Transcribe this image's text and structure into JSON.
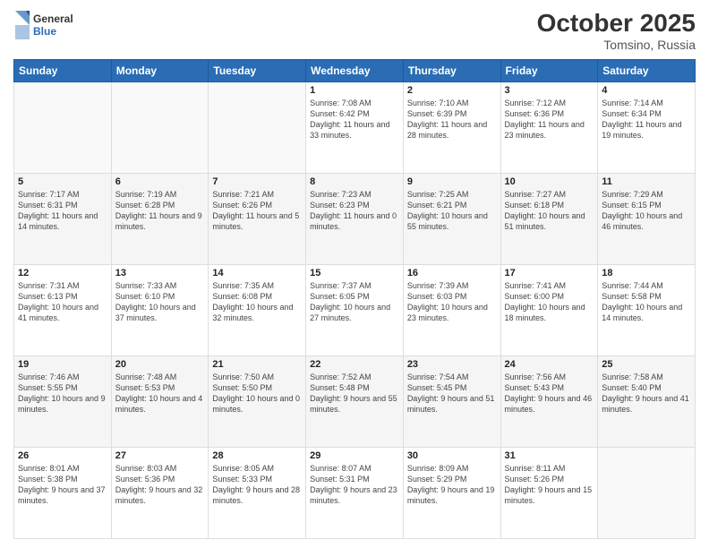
{
  "header": {
    "logo_general": "General",
    "logo_blue": "Blue",
    "title": "October 2025",
    "location": "Tomsino, Russia"
  },
  "weekdays": [
    "Sunday",
    "Monday",
    "Tuesday",
    "Wednesday",
    "Thursday",
    "Friday",
    "Saturday"
  ],
  "weeks": [
    [
      {
        "day": "",
        "sunrise": "",
        "sunset": "",
        "daylight": ""
      },
      {
        "day": "",
        "sunrise": "",
        "sunset": "",
        "daylight": ""
      },
      {
        "day": "",
        "sunrise": "",
        "sunset": "",
        "daylight": ""
      },
      {
        "day": "1",
        "sunrise": "Sunrise: 7:08 AM",
        "sunset": "Sunset: 6:42 PM",
        "daylight": "Daylight: 11 hours and 33 minutes."
      },
      {
        "day": "2",
        "sunrise": "Sunrise: 7:10 AM",
        "sunset": "Sunset: 6:39 PM",
        "daylight": "Daylight: 11 hours and 28 minutes."
      },
      {
        "day": "3",
        "sunrise": "Sunrise: 7:12 AM",
        "sunset": "Sunset: 6:36 PM",
        "daylight": "Daylight: 11 hours and 23 minutes."
      },
      {
        "day": "4",
        "sunrise": "Sunrise: 7:14 AM",
        "sunset": "Sunset: 6:34 PM",
        "daylight": "Daylight: 11 hours and 19 minutes."
      }
    ],
    [
      {
        "day": "5",
        "sunrise": "Sunrise: 7:17 AM",
        "sunset": "Sunset: 6:31 PM",
        "daylight": "Daylight: 11 hours and 14 minutes."
      },
      {
        "day": "6",
        "sunrise": "Sunrise: 7:19 AM",
        "sunset": "Sunset: 6:28 PM",
        "daylight": "Daylight: 11 hours and 9 minutes."
      },
      {
        "day": "7",
        "sunrise": "Sunrise: 7:21 AM",
        "sunset": "Sunset: 6:26 PM",
        "daylight": "Daylight: 11 hours and 5 minutes."
      },
      {
        "day": "8",
        "sunrise": "Sunrise: 7:23 AM",
        "sunset": "Sunset: 6:23 PM",
        "daylight": "Daylight: 11 hours and 0 minutes."
      },
      {
        "day": "9",
        "sunrise": "Sunrise: 7:25 AM",
        "sunset": "Sunset: 6:21 PM",
        "daylight": "Daylight: 10 hours and 55 minutes."
      },
      {
        "day": "10",
        "sunrise": "Sunrise: 7:27 AM",
        "sunset": "Sunset: 6:18 PM",
        "daylight": "Daylight: 10 hours and 51 minutes."
      },
      {
        "day": "11",
        "sunrise": "Sunrise: 7:29 AM",
        "sunset": "Sunset: 6:15 PM",
        "daylight": "Daylight: 10 hours and 46 minutes."
      }
    ],
    [
      {
        "day": "12",
        "sunrise": "Sunrise: 7:31 AM",
        "sunset": "Sunset: 6:13 PM",
        "daylight": "Daylight: 10 hours and 41 minutes."
      },
      {
        "day": "13",
        "sunrise": "Sunrise: 7:33 AM",
        "sunset": "Sunset: 6:10 PM",
        "daylight": "Daylight: 10 hours and 37 minutes."
      },
      {
        "day": "14",
        "sunrise": "Sunrise: 7:35 AM",
        "sunset": "Sunset: 6:08 PM",
        "daylight": "Daylight: 10 hours and 32 minutes."
      },
      {
        "day": "15",
        "sunrise": "Sunrise: 7:37 AM",
        "sunset": "Sunset: 6:05 PM",
        "daylight": "Daylight: 10 hours and 27 minutes."
      },
      {
        "day": "16",
        "sunrise": "Sunrise: 7:39 AM",
        "sunset": "Sunset: 6:03 PM",
        "daylight": "Daylight: 10 hours and 23 minutes."
      },
      {
        "day": "17",
        "sunrise": "Sunrise: 7:41 AM",
        "sunset": "Sunset: 6:00 PM",
        "daylight": "Daylight: 10 hours and 18 minutes."
      },
      {
        "day": "18",
        "sunrise": "Sunrise: 7:44 AM",
        "sunset": "Sunset: 5:58 PM",
        "daylight": "Daylight: 10 hours and 14 minutes."
      }
    ],
    [
      {
        "day": "19",
        "sunrise": "Sunrise: 7:46 AM",
        "sunset": "Sunset: 5:55 PM",
        "daylight": "Daylight: 10 hours and 9 minutes."
      },
      {
        "day": "20",
        "sunrise": "Sunrise: 7:48 AM",
        "sunset": "Sunset: 5:53 PM",
        "daylight": "Daylight: 10 hours and 4 minutes."
      },
      {
        "day": "21",
        "sunrise": "Sunrise: 7:50 AM",
        "sunset": "Sunset: 5:50 PM",
        "daylight": "Daylight: 10 hours and 0 minutes."
      },
      {
        "day": "22",
        "sunrise": "Sunrise: 7:52 AM",
        "sunset": "Sunset: 5:48 PM",
        "daylight": "Daylight: 9 hours and 55 minutes."
      },
      {
        "day": "23",
        "sunrise": "Sunrise: 7:54 AM",
        "sunset": "Sunset: 5:45 PM",
        "daylight": "Daylight: 9 hours and 51 minutes."
      },
      {
        "day": "24",
        "sunrise": "Sunrise: 7:56 AM",
        "sunset": "Sunset: 5:43 PM",
        "daylight": "Daylight: 9 hours and 46 minutes."
      },
      {
        "day": "25",
        "sunrise": "Sunrise: 7:58 AM",
        "sunset": "Sunset: 5:40 PM",
        "daylight": "Daylight: 9 hours and 41 minutes."
      }
    ],
    [
      {
        "day": "26",
        "sunrise": "Sunrise: 8:01 AM",
        "sunset": "Sunset: 5:38 PM",
        "daylight": "Daylight: 9 hours and 37 minutes."
      },
      {
        "day": "27",
        "sunrise": "Sunrise: 8:03 AM",
        "sunset": "Sunset: 5:36 PM",
        "daylight": "Daylight: 9 hours and 32 minutes."
      },
      {
        "day": "28",
        "sunrise": "Sunrise: 8:05 AM",
        "sunset": "Sunset: 5:33 PM",
        "daylight": "Daylight: 9 hours and 28 minutes."
      },
      {
        "day": "29",
        "sunrise": "Sunrise: 8:07 AM",
        "sunset": "Sunset: 5:31 PM",
        "daylight": "Daylight: 9 hours and 23 minutes."
      },
      {
        "day": "30",
        "sunrise": "Sunrise: 8:09 AM",
        "sunset": "Sunset: 5:29 PM",
        "daylight": "Daylight: 9 hours and 19 minutes."
      },
      {
        "day": "31",
        "sunrise": "Sunrise: 8:11 AM",
        "sunset": "Sunset: 5:26 PM",
        "daylight": "Daylight: 9 hours and 15 minutes."
      },
      {
        "day": "",
        "sunrise": "",
        "sunset": "",
        "daylight": ""
      }
    ]
  ]
}
